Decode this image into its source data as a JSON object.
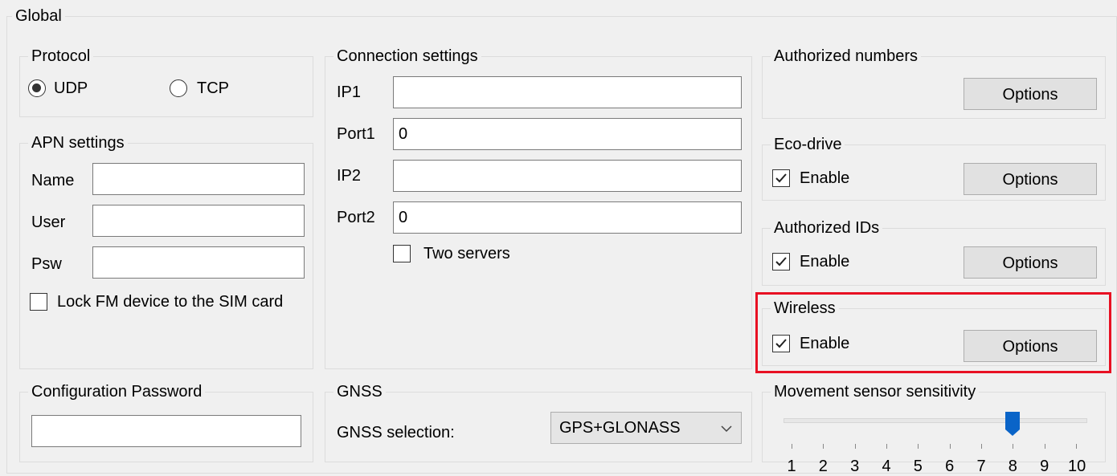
{
  "global": {
    "title": "Global"
  },
  "protocol": {
    "title": "Protocol",
    "udp_label": "UDP",
    "tcp_label": "TCP",
    "selected": "UDP"
  },
  "apn": {
    "title": "APN settings",
    "name_label": "Name",
    "name_value": "",
    "user_label": "User",
    "user_value": "",
    "psw_label": "Psw",
    "psw_value": "",
    "lock_label": "Lock FM device to the SIM card",
    "lock_checked": false
  },
  "connection": {
    "title": "Connection settings",
    "ip1_label": "IP1",
    "ip1_value": "",
    "port1_label": "Port1",
    "port1_value": "0",
    "ip2_label": "IP2",
    "ip2_value": "",
    "port2_label": "Port2",
    "port2_value": "0",
    "two_servers_label": "Two servers",
    "two_servers_checked": false
  },
  "authorized_numbers": {
    "title": "Authorized numbers",
    "options_label": "Options"
  },
  "eco_drive": {
    "title": "Eco-drive",
    "enable_label": "Enable",
    "enabled": true,
    "options_label": "Options"
  },
  "authorized_ids": {
    "title": "Authorized IDs",
    "enable_label": "Enable",
    "enabled": true,
    "options_label": "Options"
  },
  "wireless": {
    "title": "Wireless",
    "enable_label": "Enable",
    "enabled": true,
    "options_label": "Options",
    "highlight_color": "#e81123"
  },
  "config_password": {
    "title": "Configuration Password",
    "value": ""
  },
  "gnss": {
    "title": "GNSS",
    "selection_label": "GNSS selection:",
    "selected_value": "GPS+GLONASS"
  },
  "movement_sensor": {
    "title": "Movement sensor sensitivity",
    "value": 8,
    "min": 1,
    "max": 10,
    "tick_labels": [
      "1",
      "2",
      "3",
      "4",
      "5",
      "6",
      "7",
      "8",
      "9",
      "10"
    ],
    "thumb_color": "#0a64c8"
  }
}
